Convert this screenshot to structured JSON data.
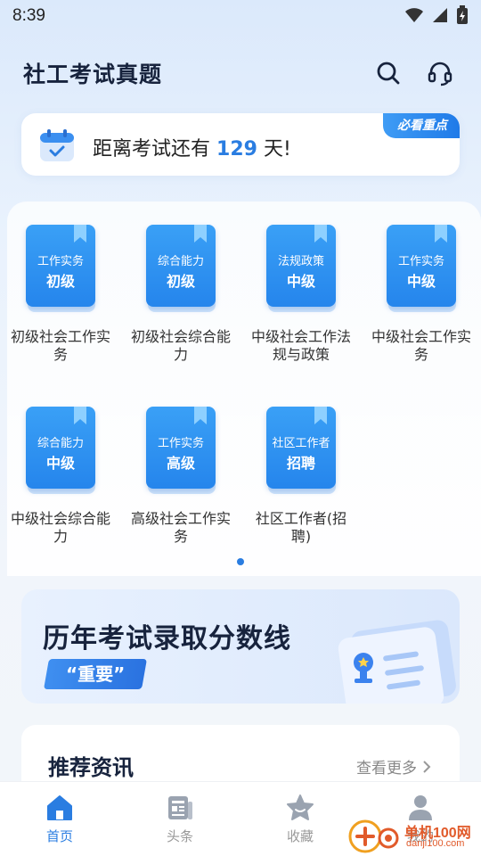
{
  "status_bar": {
    "time": "8:39"
  },
  "header": {
    "title": "社工考试真题",
    "search_icon": "search-icon",
    "service_icon": "headset-icon"
  },
  "countdown": {
    "prefix": "距离考试还有",
    "days": "129",
    "suffix": "天!",
    "badge": "必看重点"
  },
  "subjects": [
    {
      "cover_line1": "工作实务",
      "cover_line2": "初级",
      "name": "初级社会工作实务"
    },
    {
      "cover_line1": "综合能力",
      "cover_line2": "初级",
      "name": "初级社会综合能力"
    },
    {
      "cover_line1": "法规政策",
      "cover_line2": "中级",
      "name": "中级社会工作法规与政策"
    },
    {
      "cover_line1": "工作实务",
      "cover_line2": "中级",
      "name": "中级社会工作实务"
    },
    {
      "cover_line1": "综合能力",
      "cover_line2": "中级",
      "name": "中级社会综合能力"
    },
    {
      "cover_line1": "工作实务",
      "cover_line2": "高级",
      "name": "高级社会工作实务"
    },
    {
      "cover_line1": "社区工作者",
      "cover_line2": "招聘",
      "name": "社区工作者(招聘)"
    }
  ],
  "banner": {
    "title": "历年考试录取分数线",
    "tag": "“重要”"
  },
  "news": {
    "title": "推荐资讯",
    "more": "查看更多"
  },
  "bottom_nav": [
    {
      "label": "首页",
      "icon": "home-icon",
      "active": true
    },
    {
      "label": "头条",
      "icon": "news-icon",
      "active": false
    },
    {
      "label": "收藏",
      "icon": "star-icon",
      "active": false
    },
    {
      "label": "我的",
      "icon": "user-icon",
      "active": false
    }
  ],
  "watermark": {
    "line1": "单机100网",
    "line2": "danji100.com"
  },
  "colors": {
    "accent": "#2a7de1",
    "title": "#17233d"
  }
}
